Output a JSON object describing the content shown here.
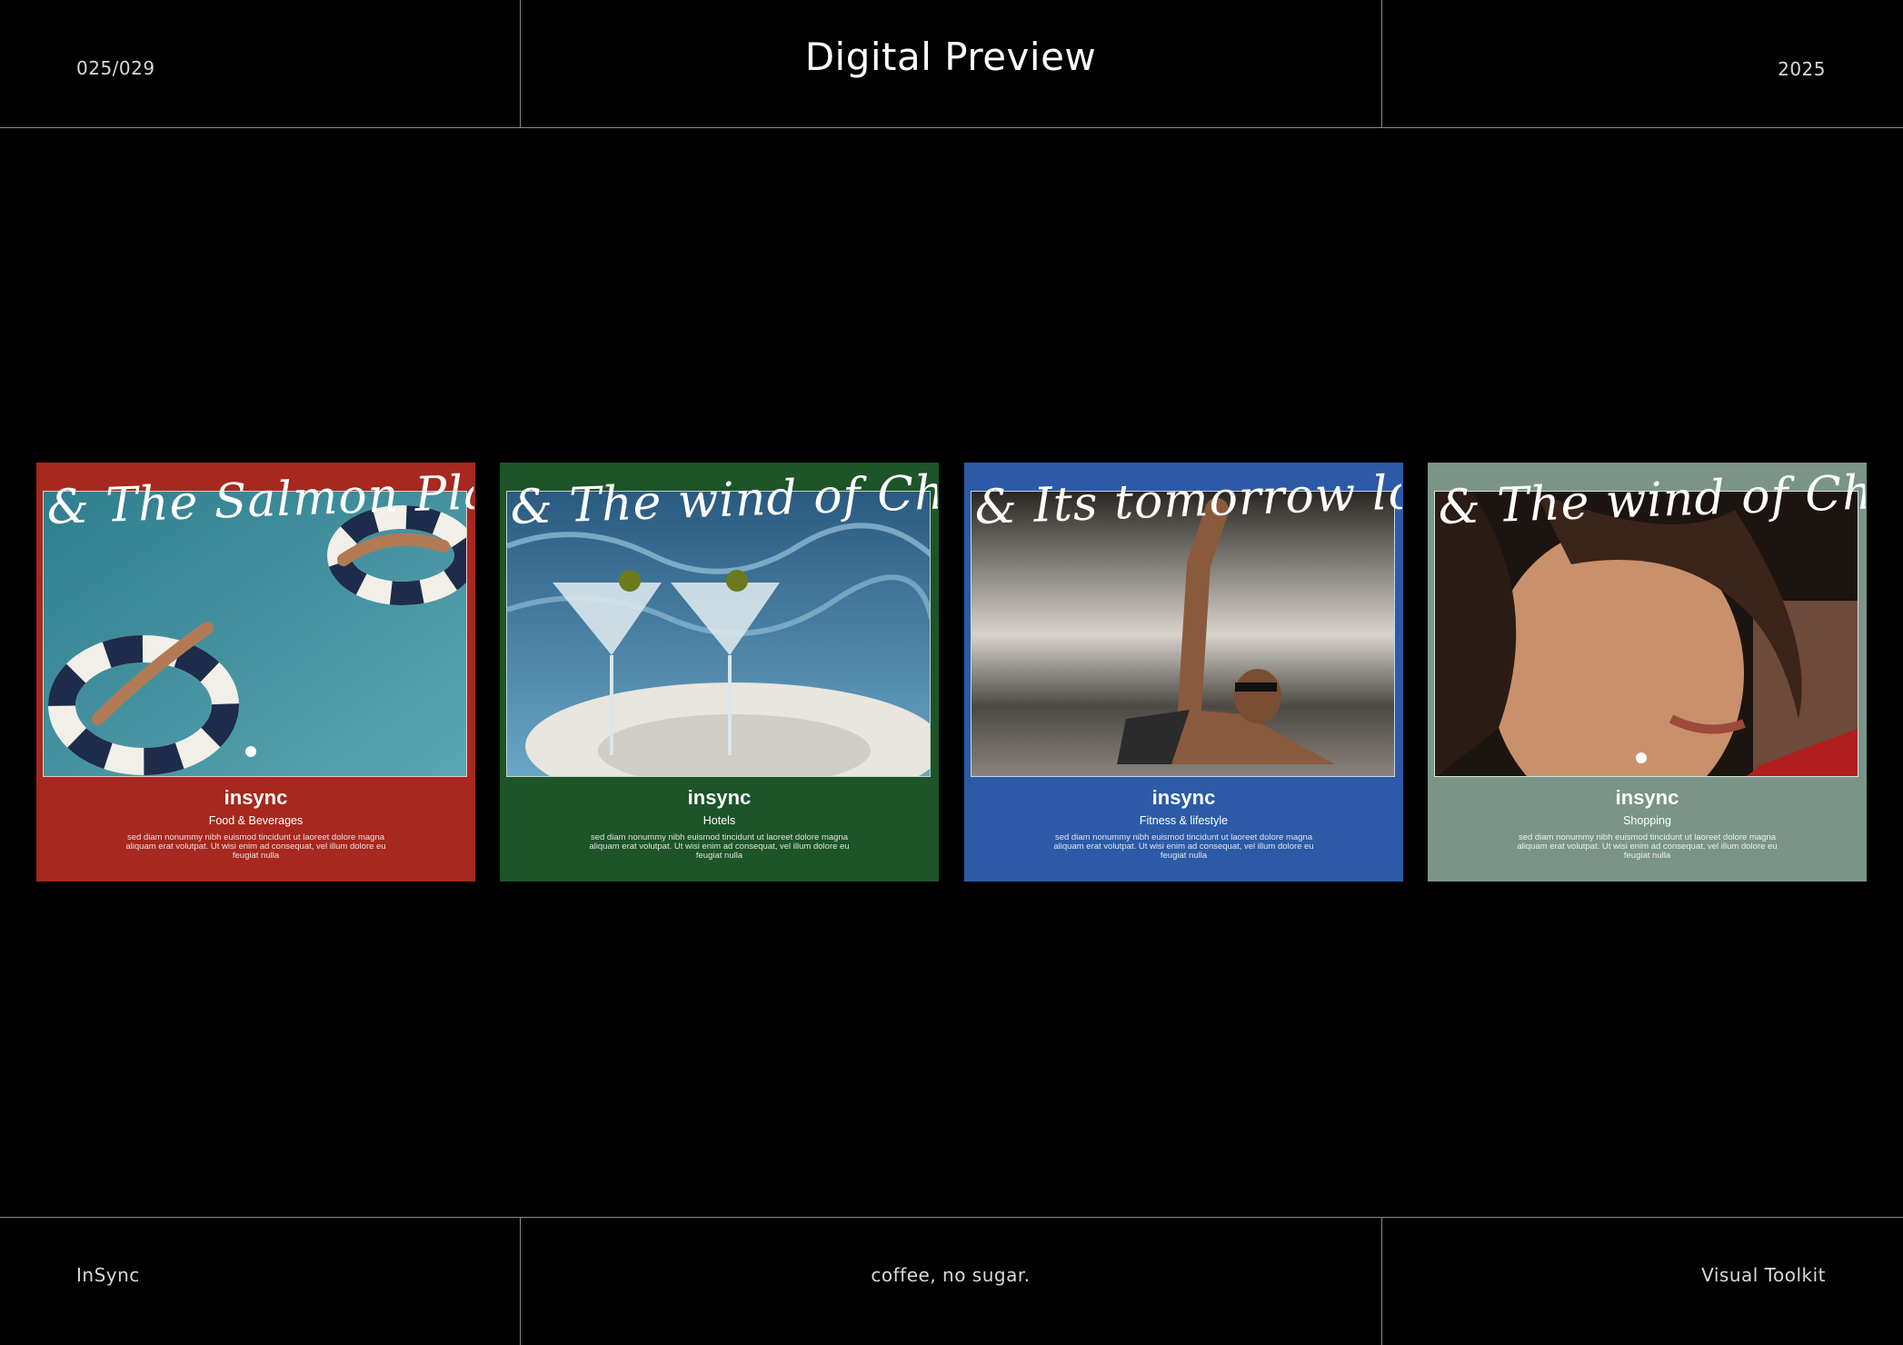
{
  "header": {
    "page_counter": "025/029",
    "title": "Digital Preview",
    "year": "2025"
  },
  "footer": {
    "brand": "InSync",
    "tagline": "coffee, no sugar.",
    "section": "Visual Toolkit"
  },
  "cards": [
    {
      "headline": "& The Salmon Playlist",
      "brand": "insync",
      "category": "Food & Beverages",
      "blurb": "sed diam nonummy nibh euismod tincidunt ut laoreet dolore magna aliquam erat volutpat. Ut wisi enim ad consequat, vel illum dolore eu feugiat nulla",
      "bg_color": "#a6281f"
    },
    {
      "headline": "& The wind of Change",
      "brand": "insync",
      "category": "Hotels",
      "blurb": "sed diam nonummy nibh euismod tincidunt ut laoreet dolore magna aliquam erat volutpat. Ut wisi enim ad consequat, vel illum dolore eu feugiat nulla",
      "bg_color": "#1d5428"
    },
    {
      "headline": "& Its tomorrow love",
      "brand": "insync",
      "category": "Fitness & lifestyle",
      "blurb": "sed diam nonummy nibh euismod tincidunt ut laoreet dolore magna aliquam erat volutpat. Ut wisi enim ad consequat, vel illum dolore eu feugiat nulla",
      "bg_color": "#2c5aa6"
    },
    {
      "headline": "& The wind of Change",
      "brand": "insync",
      "category": "Shopping",
      "blurb": "sed diam nonummy nibh euismod tincidunt ut laoreet dolore magna aliquam erat volutpat. Ut wisi enim ad consequat, vel illum dolore eu feugiat nulla",
      "bg_color": "#7a9488"
    }
  ]
}
